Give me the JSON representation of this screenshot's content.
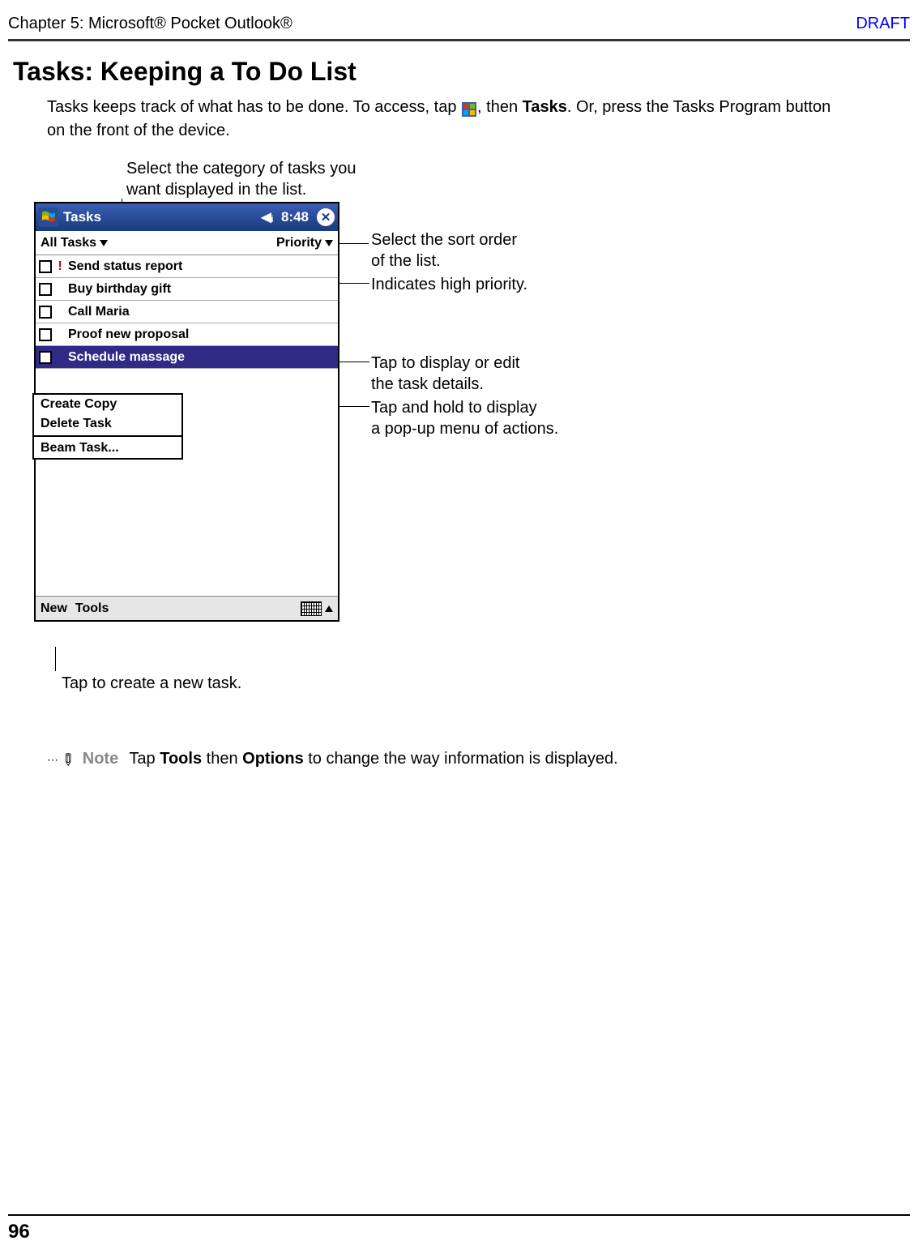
{
  "header": {
    "chapter": "Chapter 5: Microsoft® Pocket Outlook®",
    "draft": "DRAFT"
  },
  "heading": "Tasks: Keeping a To Do List",
  "intro": {
    "part1": "Tasks keeps track of what has to be done. To access, tap ",
    "part2": ", then ",
    "tasks_bold": "Tasks",
    "part3": ". Or, press the Tasks Program button on the front of the device."
  },
  "callouts": {
    "category": "Select the category of tasks you want displayed in the list.",
    "sort_l1": "Select the sort order",
    "sort_l2": "of the list.",
    "priority": "Indicates high priority.",
    "edit_l1": "Tap to display or edit",
    "edit_l2": "the task details.",
    "popup_l1": "Tap and hold to display",
    "popup_l2": "a pop-up menu of actions.",
    "newtask": "Tap to create a new task."
  },
  "device": {
    "title": "Tasks",
    "time": "8:48",
    "filter_left": "All Tasks",
    "filter_right": "Priority",
    "tasks": [
      {
        "label": "Send status report",
        "priority": true,
        "selected": false
      },
      {
        "label": "Buy birthday gift",
        "priority": false,
        "selected": false
      },
      {
        "label": "Call Maria",
        "priority": false,
        "selected": false
      },
      {
        "label": "Proof new proposal",
        "priority": false,
        "selected": false
      },
      {
        "label": "Schedule massage",
        "priority": false,
        "selected": true
      }
    ],
    "context_menu": {
      "item1": "Create Copy",
      "item2": "Delete Task",
      "item3": "Beam Task..."
    },
    "footer": {
      "new": "New",
      "tools": "Tools"
    }
  },
  "note": {
    "label": "Note",
    "text_p1": "Tap ",
    "tools_bold": "Tools",
    "text_p2": " then ",
    "options_bold": "Options",
    "text_p3": " to change the way information is displayed."
  },
  "page_number": "96"
}
